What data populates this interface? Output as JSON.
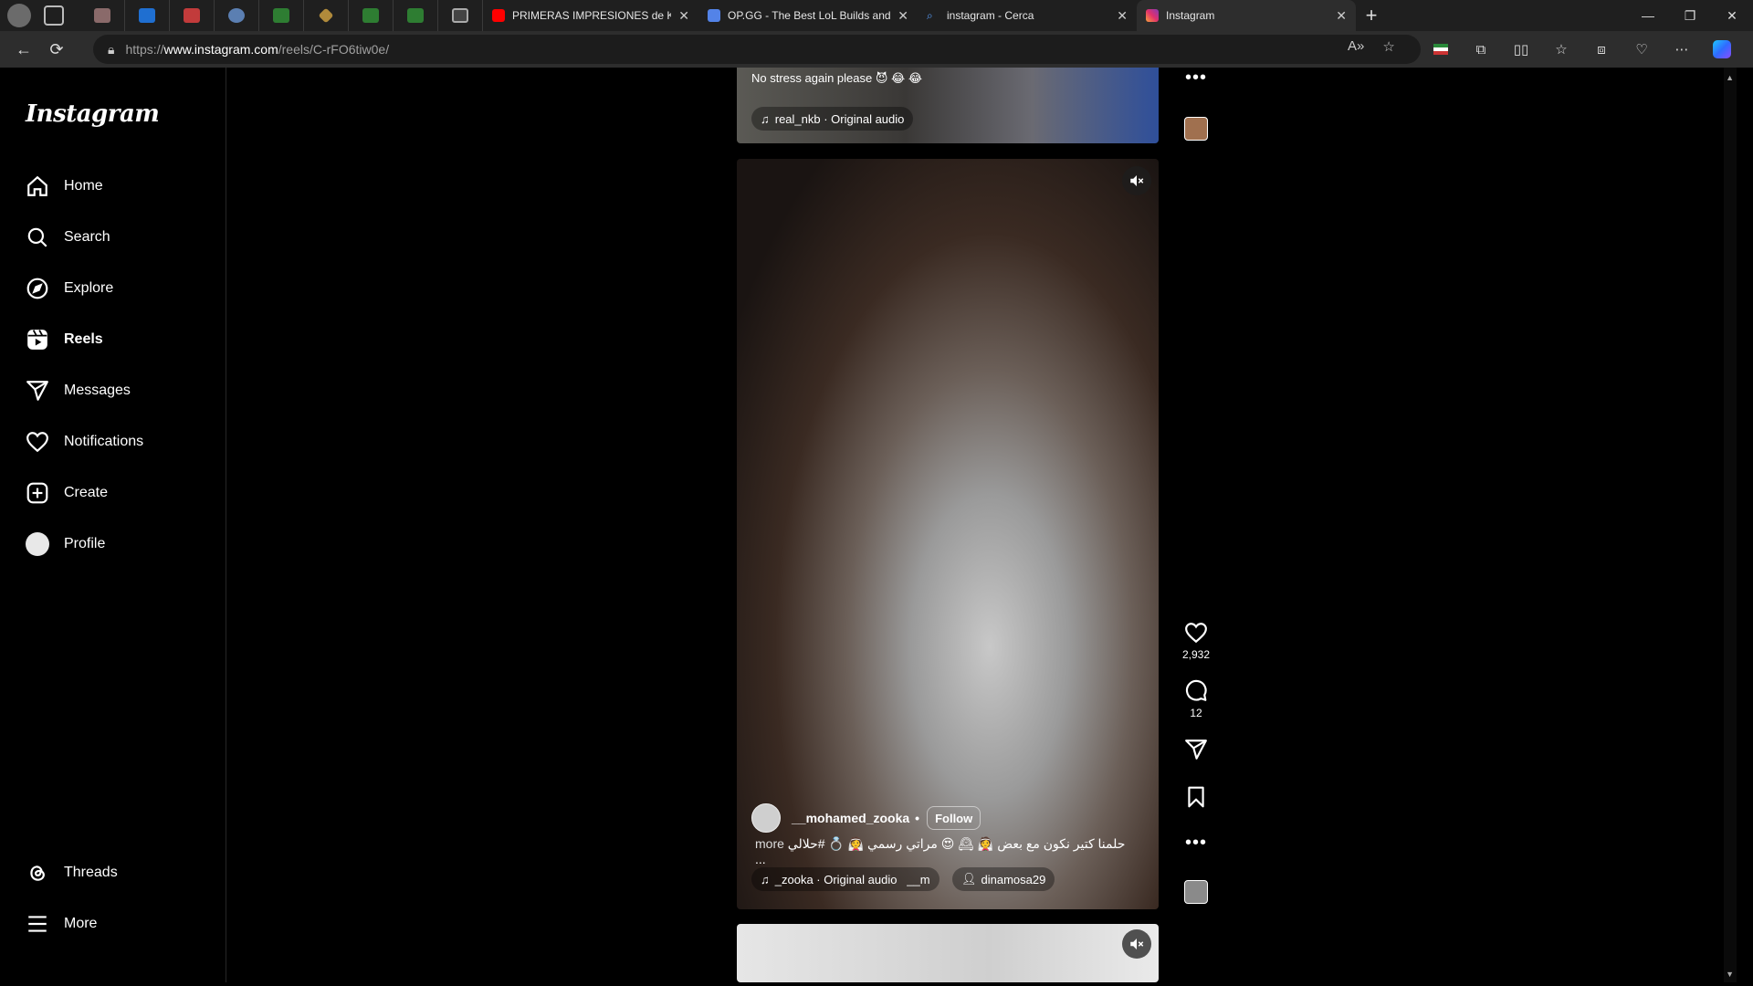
{
  "browser": {
    "tabs": [
      {
        "title": "PRIMERAS IMPRESIONES de K",
        "favicon_color": "#ff0000"
      },
      {
        "title": "OP.GG - The Best LoL Builds and",
        "favicon_color": "#5383e8"
      },
      {
        "title": "instagram - Cerca",
        "favicon_color": "#3b82f6"
      },
      {
        "title": "Instagram",
        "favicon_color": "#e1306c"
      }
    ],
    "url_prefix": "https://",
    "url_host": "www.instagram.com",
    "url_path": "/reels/C-rFO6tiw0e/"
  },
  "sidebar": {
    "logo": "Instagram",
    "items": [
      {
        "label": "Home",
        "icon": "home-icon"
      },
      {
        "label": "Search",
        "icon": "search-icon"
      },
      {
        "label": "Explore",
        "icon": "compass-icon"
      },
      {
        "label": "Reels",
        "icon": "reels-icon"
      },
      {
        "label": "Messages",
        "icon": "send-icon"
      },
      {
        "label": "Notifications",
        "icon": "heart-icon"
      },
      {
        "label": "Create",
        "icon": "plus-square-icon"
      },
      {
        "label": "Profile",
        "icon": "avatar-icon"
      }
    ],
    "bottom": [
      {
        "label": "Threads",
        "icon": "threads-icon"
      },
      {
        "label": "More",
        "icon": "menu-icon"
      }
    ]
  },
  "reel_top": {
    "caption": "No stress again please 😈 😂 😂",
    "audio": "real_nkb · Original audio"
  },
  "reel_main": {
    "username": "__mohamed_zooka",
    "follow_label": "Follow",
    "caption_more": "more",
    "caption_text": "حلمنا كتير نكون مع بعض 👰 🕰 😍 مراتي رسمي 👰 💍 #حلالي ...",
    "audio": "_zooka · Original audio   __m",
    "tagged_user": "dinamosa29"
  },
  "actions": {
    "likes": "2,932",
    "comments": "12"
  }
}
